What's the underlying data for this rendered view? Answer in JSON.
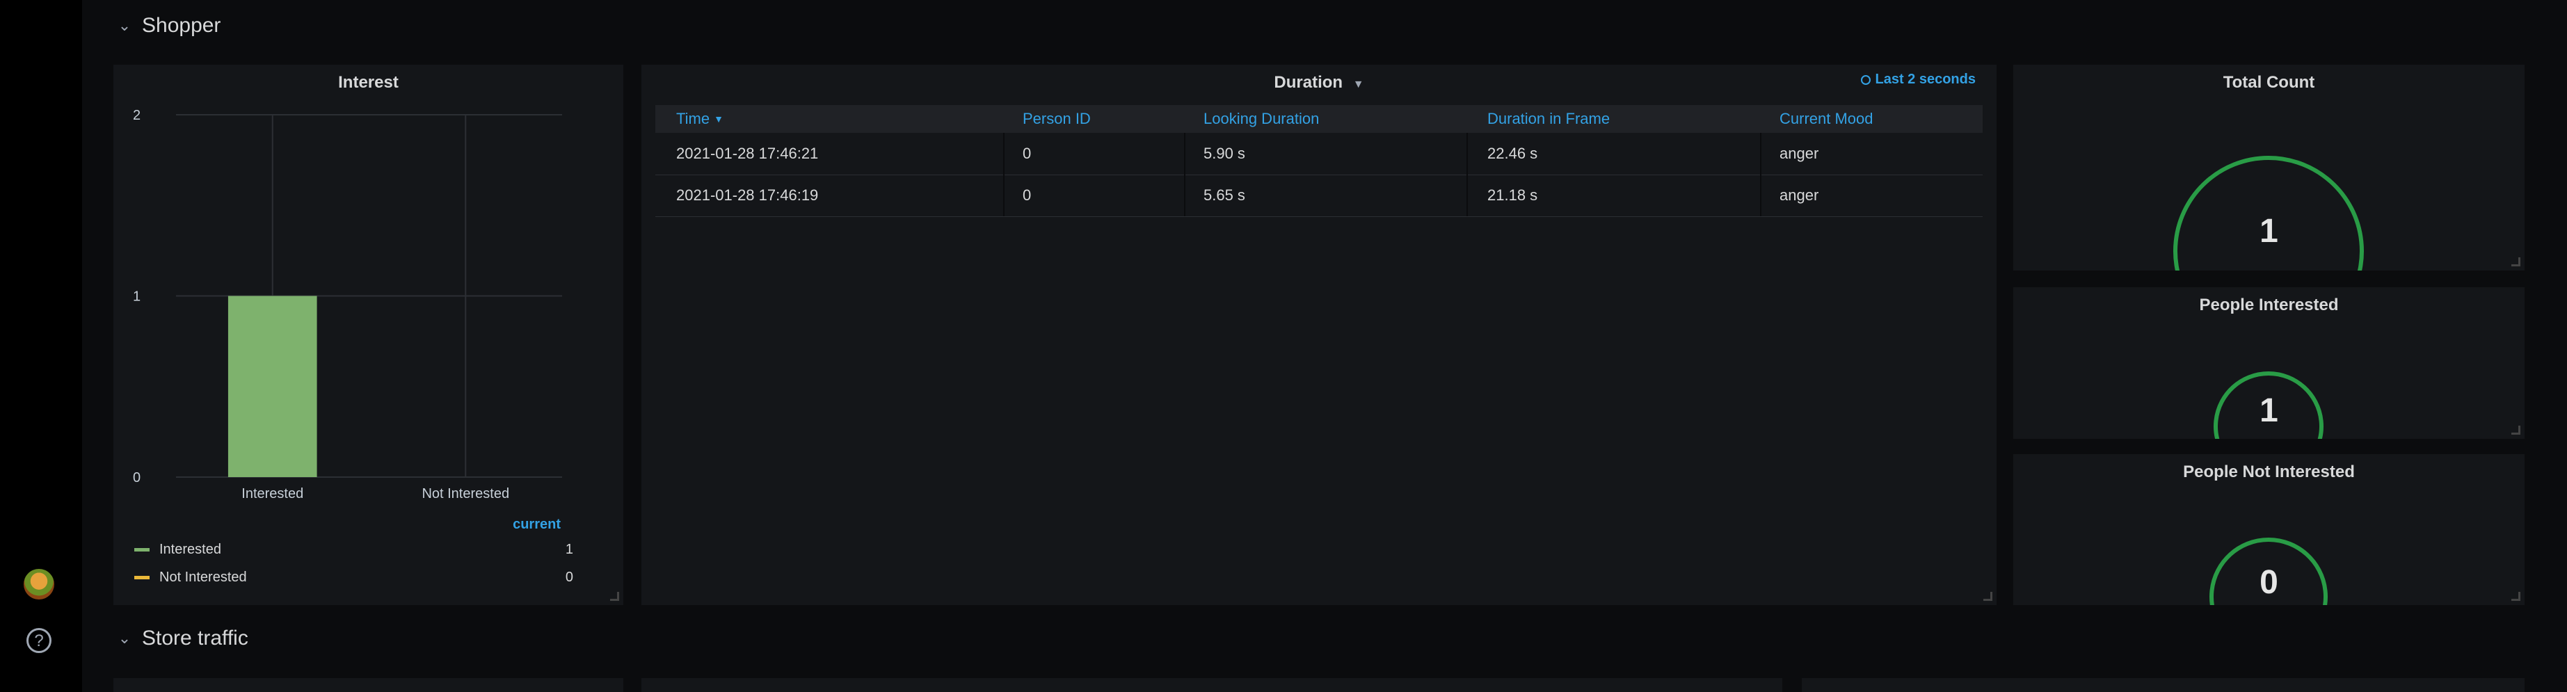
{
  "rows": {
    "shopper": {
      "title": "Shopper"
    },
    "store_traffic": {
      "title": "Store traffic"
    }
  },
  "interest_panel": {
    "title": "Interest",
    "legend_header": "current",
    "legend": [
      {
        "label": "Interested",
        "value": "1",
        "color": "#7eb26d"
      },
      {
        "label": "Not Interested",
        "value": "0",
        "color": "#eab839"
      }
    ]
  },
  "chart_data": {
    "type": "bar",
    "title": "Interest",
    "categories": [
      "Interested",
      "Not Interested"
    ],
    "values": [
      1,
      0
    ],
    "y_ticks": [
      "0",
      "1",
      "2"
    ],
    "ylim": [
      0,
      2
    ],
    "bar_color": "#7eb26d",
    "grid": true
  },
  "duration_panel": {
    "title": "Duration",
    "time_range": "Last 2 seconds",
    "columns": [
      "Time",
      "Person ID",
      "Looking Duration",
      "Duration in Frame",
      "Current Mood"
    ],
    "rows": [
      [
        "2021-01-28 17:46:21",
        "0",
        "5.90 s",
        "22.46 s",
        "anger"
      ],
      [
        "2021-01-28 17:46:19",
        "0",
        "5.65 s",
        "21.18 s",
        "anger"
      ]
    ]
  },
  "stats": [
    {
      "title": "Total Count",
      "value": "1",
      "fraction": 0.05
    },
    {
      "title": "People Interested",
      "value": "1",
      "fraction": 0.05
    },
    {
      "title": "People Not Interested",
      "value": "0",
      "fraction": 0
    }
  ],
  "colors": {
    "gauge": "#299c46",
    "header_link": "#33a2e5",
    "panel_bg": "#141619"
  },
  "icons": {
    "collapse": "chevron-down-icon",
    "help": "help-icon",
    "clock": "clock-icon",
    "sort": "caret-down-icon"
  }
}
